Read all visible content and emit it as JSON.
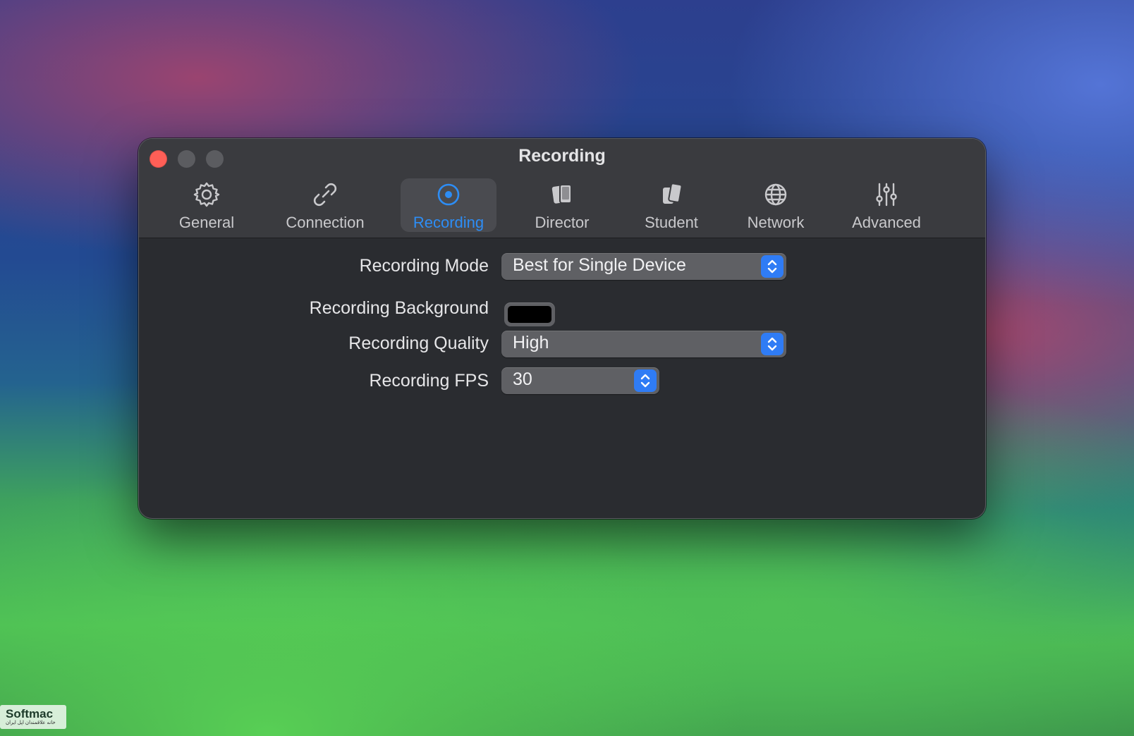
{
  "window": {
    "title": "Recording",
    "controls": {
      "close_color": "#ff5f57",
      "minimize_color": "#5b5c60",
      "zoom_color": "#5b5c60"
    }
  },
  "toolbar": {
    "active_tab": "Recording",
    "accent_color": "#2d8df5",
    "tabs": [
      {
        "label": "General",
        "icon": "gear-icon"
      },
      {
        "label": "Connection",
        "icon": "link-icon"
      },
      {
        "label": "Recording",
        "icon": "record-icon"
      },
      {
        "label": "Director",
        "icon": "director-cards-icon"
      },
      {
        "label": "Student",
        "icon": "student-cards-icon"
      },
      {
        "label": "Network",
        "icon": "globe-icon"
      },
      {
        "label": "Advanced",
        "icon": "sliders-icon"
      }
    ]
  },
  "settings": {
    "recording_mode": {
      "label": "Recording Mode",
      "value": "Best for Single Device"
    },
    "recording_background": {
      "label": "Recording Background",
      "color": "#000000"
    },
    "recording_quality": {
      "label": "Recording Quality",
      "value": "High"
    },
    "recording_fps": {
      "label": "Recording FPS",
      "value": "30"
    }
  },
  "watermark": {
    "brand": "Softmac",
    "tagline": "خانه علاقمندان اپل ایران"
  }
}
